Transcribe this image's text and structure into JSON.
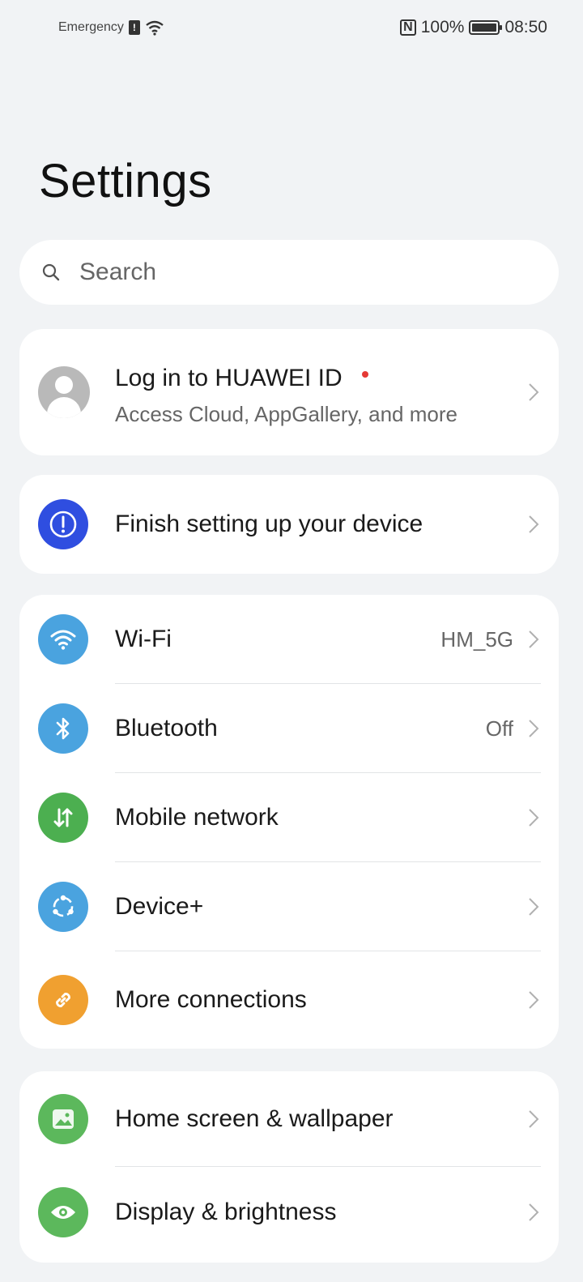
{
  "status_bar": {
    "left_text": "Emergency",
    "battery": "100%",
    "time": "08:50"
  },
  "page": {
    "title": "Settings"
  },
  "search": {
    "placeholder": "Search"
  },
  "account": {
    "title": "Log in to HUAWEI ID",
    "subtitle": "Access Cloud, AppGallery, and more"
  },
  "setup": {
    "label": "Finish setting up your device"
  },
  "connectivity": [
    {
      "label": "Wi-Fi",
      "value": "HM_5G",
      "icon": "wifi-icon",
      "color": "#4aa3df"
    },
    {
      "label": "Bluetooth",
      "value": "Off",
      "icon": "bluetooth-icon",
      "color": "#4aa3df"
    },
    {
      "label": "Mobile network",
      "value": "",
      "icon": "mobile-network-icon",
      "color": "#4caf50"
    },
    {
      "label": "Device+",
      "value": "",
      "icon": "device-plus-icon",
      "color": "#4aa3df"
    },
    {
      "label": "More connections",
      "value": "",
      "icon": "link-icon",
      "color": "#f0a030"
    }
  ],
  "display": [
    {
      "label": "Home screen & wallpaper",
      "icon": "image-icon",
      "color": "#5cb85c"
    },
    {
      "label": "Display & brightness",
      "icon": "eye-icon",
      "color": "#5cb85c"
    }
  ],
  "colors": {
    "setup_icon": "#2f4ee0"
  }
}
